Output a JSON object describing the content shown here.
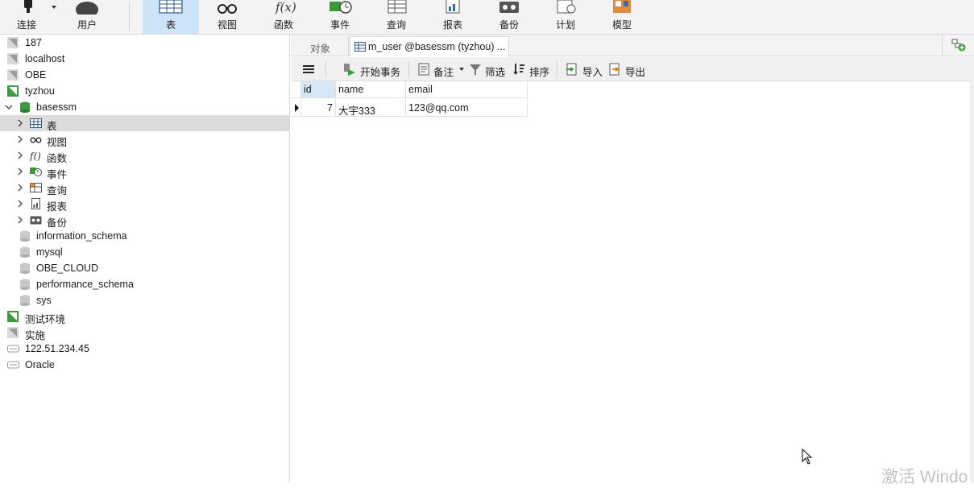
{
  "toolbar": {
    "items": [
      {
        "label": "连接",
        "icon": "plug-icon"
      },
      {
        "label": "用户",
        "icon": "user-icon"
      },
      {
        "label": "表",
        "icon": "table-icon",
        "active": true
      },
      {
        "label": "视图",
        "icon": "glasses-icon"
      },
      {
        "label": "函数",
        "icon": "function-icon"
      },
      {
        "label": "事件",
        "icon": "event-clock-icon"
      },
      {
        "label": "查询",
        "icon": "query-icon"
      },
      {
        "label": "报表",
        "icon": "report-icon"
      },
      {
        "label": "备份",
        "icon": "backup-icon"
      },
      {
        "label": "计划",
        "icon": "schedule-icon"
      },
      {
        "label": "模型",
        "icon": "model-icon"
      }
    ],
    "active_color": "#cde3f7"
  },
  "tree": {
    "items": [
      {
        "label": "187",
        "icon": "connection-gray-icon"
      },
      {
        "label": "localhost",
        "icon": "connection-gray-icon"
      },
      {
        "label": "OBE",
        "icon": "connection-gray-icon"
      },
      {
        "label": "tyzhou",
        "icon": "connection-green-icon"
      },
      {
        "label": "basessm",
        "icon": "database-green-icon"
      },
      {
        "label": "表",
        "icon": "table-icon",
        "selected": true
      },
      {
        "label": "视图",
        "icon": "glasses-icon"
      },
      {
        "label": "函数",
        "icon": "function-icon"
      },
      {
        "label": "事件",
        "icon": "event-clock-icon"
      },
      {
        "label": "查询",
        "icon": "query-icon"
      },
      {
        "label": "报表",
        "icon": "report-icon"
      },
      {
        "label": "备份",
        "icon": "backup-icon"
      },
      {
        "label": "information_schema",
        "icon": "database-gray-icon"
      },
      {
        "label": "mysql",
        "icon": "database-gray-icon"
      },
      {
        "label": "OBE_CLOUD",
        "icon": "database-gray-icon"
      },
      {
        "label": "performance_schema",
        "icon": "database-gray-icon"
      },
      {
        "label": "sys",
        "icon": "database-gray-icon"
      },
      {
        "label": "测试环境",
        "icon": "connection-green-icon"
      },
      {
        "label": "实施",
        "icon": "connection-gray-icon"
      },
      {
        "label": "122.51.234.45",
        "icon": "server-gray-icon"
      },
      {
        "label": "Oracle",
        "icon": "server-gray-icon"
      }
    ]
  },
  "tabs": {
    "objects": "对象",
    "active": "m_user @basessm (tyzhou) ..."
  },
  "subtoolbar": {
    "begin_transaction": "开始事务",
    "notes": "备注",
    "filter": "筛选",
    "sort": "排序",
    "import": "导入",
    "export": "导出"
  },
  "grid": {
    "columns": [
      "id",
      "name",
      "email"
    ],
    "rows": [
      [
        "7",
        "大宇333",
        "123@qq.com"
      ]
    ]
  },
  "watermark": "激活 Windo"
}
